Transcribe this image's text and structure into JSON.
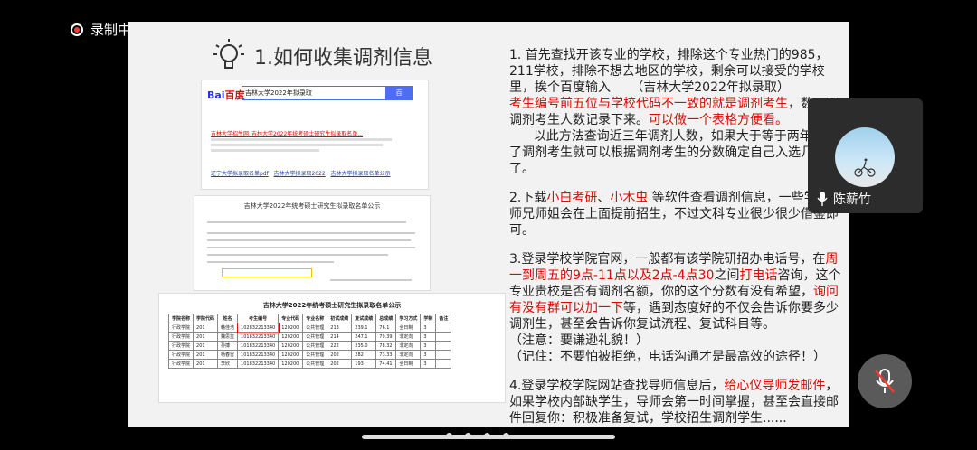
{
  "recording": {
    "label": "录制中"
  },
  "slide": {
    "title": "1.如何收集调剂信息",
    "screenshots": {
      "baidu": {
        "logo_left": "Bai",
        "logo_right": "百度",
        "query": "吉林大学2022年拟录取",
        "search_button": "百",
        "result_title": "吉林大学招生网_吉林大学2022年统考硕士研究生拟录取名单...",
        "related_items": [
          "辽宁大学拟录取名单pdf",
          "吉林大学拟录取2022",
          "吉林大学拟录取名单公示"
        ]
      },
      "notice": {
        "heading": "吉林大学2022年统考硕士研究生拟录取名单公示"
      },
      "table": {
        "heading": "吉林大学2022年统考硕士研究生拟录取名单公示",
        "columns": [
          "学院名称",
          "学院代码",
          "姓名",
          "考生编号",
          "专业代码",
          "专业名称",
          "初试成绩",
          "复试成绩",
          "总成绩",
          "学习方式",
          "学制",
          "备注"
        ],
        "rows": [
          [
            "行政学院",
            "201",
            "韩佳浩",
            "102832213340",
            "120200",
            "公共管理",
            "213",
            "239.1",
            "76.1",
            "全日制",
            "3",
            ""
          ],
          [
            "行政学院",
            "201",
            "魏思玺",
            "101832213340",
            "120200",
            "公共管理",
            "214",
            "247.1",
            "79.39",
            "非定向",
            "3",
            ""
          ],
          [
            "行政学院",
            "201",
            "孙搏",
            "101832213340",
            "120200",
            "公共管理",
            "222",
            "235.0",
            "78.32",
            "非定向",
            "3",
            ""
          ],
          [
            "行政学院",
            "201",
            "杨春雷",
            "101832213340",
            "120200",
            "公共管理",
            "202",
            "282",
            "73.33",
            "非定向",
            "3",
            ""
          ],
          [
            "行政学院",
            "201",
            "李欣",
            "101832213340",
            "120200",
            "公共管理",
            "202",
            "193",
            "74.41",
            "全日制",
            "3",
            ""
          ]
        ]
      }
    },
    "paragraphs": {
      "p1_a": "1. 首先查找开该专业的学校，排除这个专业热门的985，211学校，排除不想去地区的学校，剩余可以接受的学校里，挨个百度输入     （吉林大学2022年拟录取）",
      "p1_b_red": "考生编号前五位与学校代码不一致的就是调剂考生",
      "p1_b_tail": "，数一下调剂考生人数记录下来。",
      "p1_b_red2": "可以做一个表格方便看。",
      "p1_c": "      以此方法查询近三年调剂人数，如果大于等于两年都收了调剂考生就可以根据调剂考生的分数确定自己入选几率了。",
      "p2_a": "2.下载",
      "p2_red1": "小白考研",
      "p2_sep": "、",
      "p2_red2": "小木虫",
      "p2_b": " 等软件查看调剂信息，一些学师，师兄师姐会在上面提前招生，不过文科专业很少很少借鉴即可。",
      "p3_a": "3.登录学校学院官网，一般都有该学院研招办电话号，在",
      "p3_red1": "周一到周五的9点-11点以及2点-4点30",
      "p3_b": "之间",
      "p3_red2": "打电话",
      "p3_c": "咨询，这个专业贵校是否有调剂名额，你的这个分数有没有希望，",
      "p3_red3": "询问有没有群可以加一下",
      "p3_d": "等，遇到态度好的不仅会告诉你要多少调剂生，甚至会告诉你复试流程、复试科目等。\n（注意：要谦逊礼貌！）\n（记住：不要怕被拒绝，电话沟通才是最高效的途径！）",
      "p4_a": "4.登录学校学院网站查找导师信息后，",
      "p4_red": "给心仪导师发邮件",
      "p4_b": "，如果学校内部缺学生，导师会第一时间掌握，甚至会直接邮件回复你：积极准备复试，学校招生调剂学生......"
    }
  },
  "participant": {
    "name": "陈薪竹"
  },
  "colors": {
    "highlight": "#e10602",
    "slide_bg": "#f2f2f2"
  }
}
